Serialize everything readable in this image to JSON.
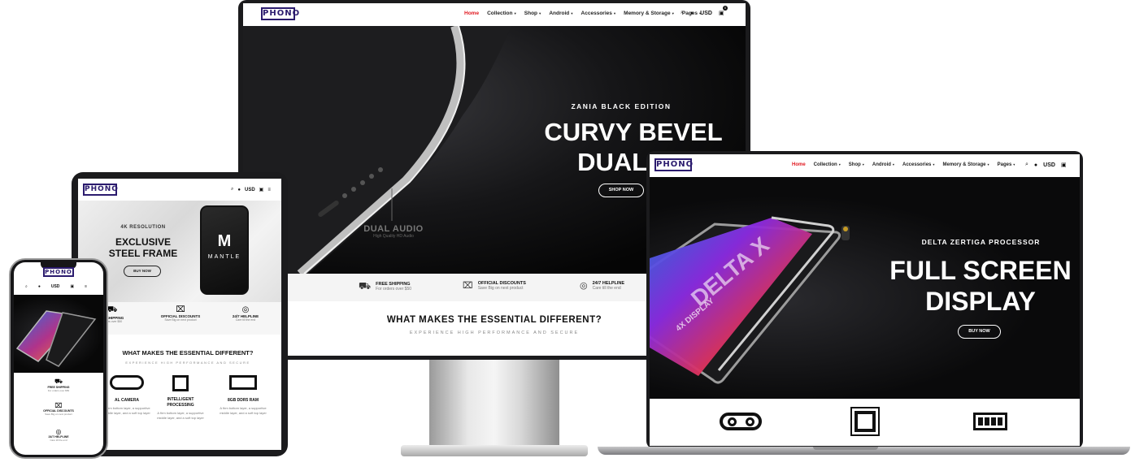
{
  "brand": {
    "logo": "PHONO",
    "accent": "#e1171e",
    "logo_color": "#2b1b6e"
  },
  "nav": {
    "items": [
      "Home",
      "Collection",
      "Shop",
      "Android",
      "Accessories",
      "Memory & Storage",
      "Pages"
    ],
    "currency": "USD",
    "cart_count": "0"
  },
  "monitor": {
    "kicker": "ZANIA BLACK EDITION",
    "title_line1": "CURVY BEVEL",
    "title_line2": "DUAL AU",
    "button": "SHOP NOW",
    "dual_audio": "DUAL AUDIO",
    "dual_audio_sub": "High Quality HD Audio",
    "features": [
      {
        "title": "FREE SHIPPING",
        "sub": "For orders over $50"
      },
      {
        "title": "OFFICIAL DISCOUNTS",
        "sub": "Save Big on next product"
      },
      {
        "title": "24/7 HELPLINE",
        "sub": "Care till the end"
      }
    ],
    "section_title": "WHAT MAKES THE ESSENTIAL DIFFERENT?",
    "section_sub": "EXPERIENCE HIGH PERFORMANCE AND SECURE"
  },
  "laptop": {
    "kicker": "DELTA ZERTIGA PROCESSOR",
    "title_line1": "FULL SCREEN",
    "title_line2": "DISPLAY",
    "button": "BUY NOW",
    "phone_text": "DELTA X",
    "phone_text2": "4X DISPLAY"
  },
  "tablet": {
    "kicker": "4K RESOLUTION",
    "title_line1": "EXCLUSIVE",
    "title_line2": "STEEL FRAME",
    "button": "BUY NOW",
    "phone_brand": "MANTLE",
    "features": [
      {
        "title": "TE SHIPPING",
        "sub": "orders over $50"
      },
      {
        "title": "OFFICIAL DISCOUNTS",
        "sub": "Save Big on next product"
      },
      {
        "title": "24/7 HELPLINE",
        "sub": "Care till the end"
      }
    ],
    "section_title": "WHAT MAKES THE ESSENTIAL DIFFERENT?",
    "section_sub": "EXPERIENCE HIGH PERFORMANCE AND SECURE",
    "cards": [
      {
        "title": "AL CAMERA",
        "desc": "A firm bottom layer, a supportive middle layer, and a soft top layer"
      },
      {
        "title": "INTELLIGENT PROCESSING",
        "desc": "A firm bottom layer, a supportive middle layer, and a soft top layer"
      },
      {
        "title": "8GB DDR5 RAM",
        "desc": "A firm bottom layer, a supportive middle layer, and a soft top layer"
      }
    ]
  },
  "phone": {
    "features": [
      {
        "title": "FREE SHIPPING",
        "sub": "For orders over $50"
      },
      {
        "title": "OFFICIAL DISCOUNTS",
        "sub": "Save Big on next product"
      },
      {
        "title": "24/7 HELPLINE",
        "sub": "Care till the end"
      }
    ]
  }
}
